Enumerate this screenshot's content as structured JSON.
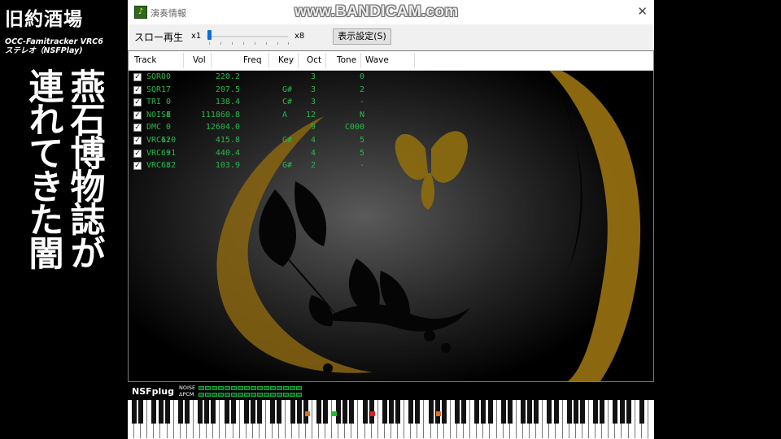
{
  "overlay": {
    "logo": "旧約酒場",
    "subtitle_line1": "OCC-Famitracker VRC6",
    "subtitle_line2": "ステレオ（NSFPlay)",
    "song_title_line1": "燕石博物誌が",
    "song_title_line2": "連れてきた闇"
  },
  "window": {
    "title": "演奏情報",
    "watermark": "www.BANDICAM.com",
    "close_glyph": "✕"
  },
  "toolbar": {
    "slow_label": "スロー再生",
    "min_label": "x1",
    "max_label": "x8",
    "slider_value": 1,
    "display_button": "表示設定(S)"
  },
  "table": {
    "headers": [
      "Track",
      "Vol",
      "Freq",
      "Key",
      "Oct",
      "Tone",
      "Wave"
    ],
    "rows": [
      {
        "track": "SQR0",
        "vol": "0",
        "freq": "220.2",
        "key": "",
        "oct": "3",
        "tone": "0",
        "checked": true
      },
      {
        "track": "SQR1",
        "vol": "7",
        "freq": "207.5",
        "key": "G#",
        "oct": "3",
        "tone": "2",
        "checked": true
      },
      {
        "track": "TRI",
        "vol": "0",
        "freq": "138.4",
        "key": "C#",
        "oct": "3",
        "tone": "-",
        "checked": true
      },
      {
        "track": "NOISE",
        "vol": "4",
        "freq": "111860.8",
        "key": "A",
        "oct": "12",
        "tone": "N",
        "checked": true
      },
      {
        "track": "DMC",
        "vol": "0",
        "freq": "12604.0",
        "key": "",
        "oct": "9",
        "tone": "C000",
        "checked": true
      },
      {
        "track": "VRC6:0",
        "vol": "12",
        "freq": "415.8",
        "key": "G#",
        "oct": "4",
        "tone": "5",
        "checked": true
      },
      {
        "track": "VRC6:1",
        "vol": "9",
        "freq": "440.4",
        "key": "",
        "oct": "4",
        "tone": "5",
        "checked": true
      },
      {
        "track": "VRC6:2",
        "vol": "8",
        "freq": "103.9",
        "key": "G#",
        "oct": "2",
        "tone": "-",
        "checked": true
      }
    ]
  },
  "status": {
    "plugin_label": "NSFplug",
    "meter_label_noise": "NOISE",
    "meter_label_dpcm": "ΔPCM",
    "noise_level": 0,
    "dpcm_level": 0
  },
  "piano": {
    "pressed_keys": [
      {
        "octave": 3,
        "color": "#e07020"
      },
      {
        "octave": 4,
        "color": "#20c030"
      },
      {
        "octave": 4,
        "color": "#e02020"
      },
      {
        "octave": 5,
        "color": "#e07020"
      }
    ]
  },
  "colors": {
    "track_text": "#29b84c",
    "art_gold": "#b8860b",
    "meter_green": "#1ea83a",
    "slider_accent": "#0f6cd4"
  }
}
